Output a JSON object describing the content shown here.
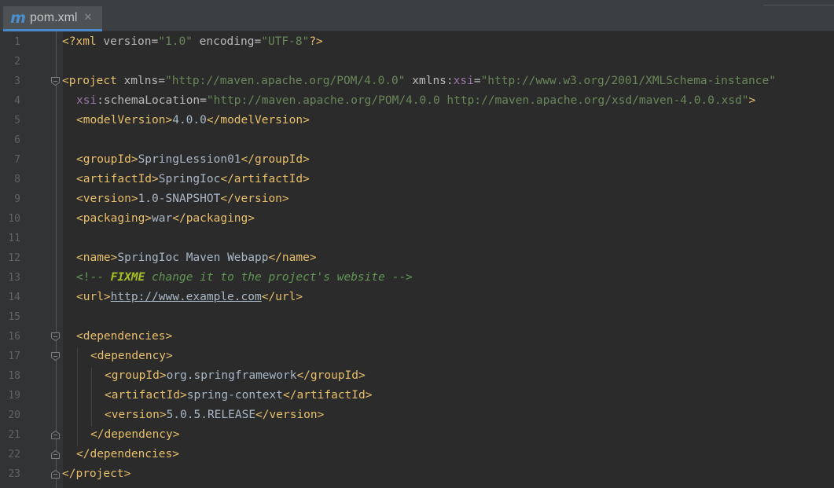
{
  "tab": {
    "icon": "maven-m-icon",
    "title": "pom.xml",
    "close": "✕",
    "active": true
  },
  "colors": {
    "tag": "#e8bf6a",
    "attribute": "#bababa",
    "namespace": "#9876aa",
    "value": "#6a8759",
    "text": "#a9b7c6",
    "comment": "#629755",
    "todo": "#a8c023",
    "accent": "#4a88c7"
  },
  "editor": {
    "lines": [
      {
        "n": "1",
        "indent": 0,
        "tokens": [
          {
            "t": "<?",
            "k": "punct"
          },
          {
            "t": "xml",
            "k": "tag"
          },
          {
            "t": " ",
            "k": "text"
          },
          {
            "t": "version",
            "k": "attr"
          },
          {
            "t": "=",
            "k": "attr"
          },
          {
            "t": "\"1.0\"",
            "k": "val"
          },
          {
            "t": " ",
            "k": "text"
          },
          {
            "t": "encoding",
            "k": "attr"
          },
          {
            "t": "=",
            "k": "attr"
          },
          {
            "t": "\"UTF-8\"",
            "k": "val"
          },
          {
            "t": "?>",
            "k": "punct"
          }
        ]
      },
      {
        "n": "2",
        "indent": 0,
        "tokens": []
      },
      {
        "n": "3",
        "indent": 0,
        "fold": "open",
        "tokens": [
          {
            "t": "<",
            "k": "punct"
          },
          {
            "t": "project",
            "k": "tag"
          },
          {
            "t": " ",
            "k": "text"
          },
          {
            "t": "xmlns",
            "k": "attr"
          },
          {
            "t": "=",
            "k": "attr"
          },
          {
            "t": "\"http://maven.apache.org/POM/4.0.0\"",
            "k": "val"
          },
          {
            "t": " ",
            "k": "text"
          },
          {
            "t": "xmlns:",
            "k": "attr"
          },
          {
            "t": "xsi",
            "k": "ns"
          },
          {
            "t": "=",
            "k": "attr"
          },
          {
            "t": "\"http://www.w3.org/2001/XMLSchema-instance\"",
            "k": "val"
          }
        ]
      },
      {
        "n": "4",
        "indent": 1,
        "tokens": [
          {
            "t": "xsi",
            "k": "ns"
          },
          {
            "t": ":schemaLocation",
            "k": "attr"
          },
          {
            "t": "=",
            "k": "attr"
          },
          {
            "t": "\"http://maven.apache.org/POM/4.0.0 http://maven.apache.org/xsd/maven-4.0.0.xsd\"",
            "k": "val"
          },
          {
            "t": ">",
            "k": "punct"
          }
        ]
      },
      {
        "n": "5",
        "indent": 1,
        "tokens": [
          {
            "t": "<modelVersion>",
            "k": "tag"
          },
          {
            "t": "4.0.0",
            "k": "text"
          },
          {
            "t": "</modelVersion>",
            "k": "tag"
          }
        ]
      },
      {
        "n": "6",
        "indent": 0,
        "tokens": []
      },
      {
        "n": "7",
        "indent": 1,
        "tokens": [
          {
            "t": "<groupId>",
            "k": "tag"
          },
          {
            "t": "SpringLession01",
            "k": "text"
          },
          {
            "t": "</groupId>",
            "k": "tag"
          }
        ]
      },
      {
        "n": "8",
        "indent": 1,
        "tokens": [
          {
            "t": "<artifactId>",
            "k": "tag"
          },
          {
            "t": "SpringIoc",
            "k": "text"
          },
          {
            "t": "</artifactId>",
            "k": "tag"
          }
        ]
      },
      {
        "n": "9",
        "indent": 1,
        "tokens": [
          {
            "t": "<version>",
            "k": "tag"
          },
          {
            "t": "1.0-SNAPSHOT",
            "k": "text"
          },
          {
            "t": "</version>",
            "k": "tag"
          }
        ]
      },
      {
        "n": "10",
        "indent": 1,
        "tokens": [
          {
            "t": "<packaging>",
            "k": "tag"
          },
          {
            "t": "war",
            "k": "text"
          },
          {
            "t": "</packaging>",
            "k": "tag"
          }
        ]
      },
      {
        "n": "11",
        "indent": 0,
        "tokens": []
      },
      {
        "n": "12",
        "indent": 1,
        "tokens": [
          {
            "t": "<name>",
            "k": "tag"
          },
          {
            "t": "SpringIoc Maven Webapp",
            "k": "text"
          },
          {
            "t": "</name>",
            "k": "tag"
          }
        ]
      },
      {
        "n": "13",
        "indent": 1,
        "tokens": [
          {
            "t": "<!--",
            "k": "cdelim"
          },
          {
            "t": " ",
            "k": "comment"
          },
          {
            "t": "FIXME",
            "k": "todo"
          },
          {
            "t": " change it to the project's website ",
            "k": "comment"
          },
          {
            "t": "-->",
            "k": "cdelim"
          }
        ]
      },
      {
        "n": "14",
        "indent": 1,
        "tokens": [
          {
            "t": "<url>",
            "k": "tag"
          },
          {
            "t": "http://www.example.com",
            "k": "url"
          },
          {
            "t": "</url>",
            "k": "tag"
          }
        ]
      },
      {
        "n": "15",
        "indent": 0,
        "tokens": []
      },
      {
        "n": "16",
        "indent": 1,
        "fold": "open",
        "tokens": [
          {
            "t": "<dependencies>",
            "k": "tag"
          }
        ]
      },
      {
        "n": "17",
        "indent": 2,
        "fold": "open",
        "tokens": [
          {
            "t": "<dependency>",
            "k": "tag"
          }
        ]
      },
      {
        "n": "18",
        "indent": 3,
        "tokens": [
          {
            "t": "<groupId>",
            "k": "tag"
          },
          {
            "t": "org.springframework",
            "k": "text"
          },
          {
            "t": "</groupId>",
            "k": "tag"
          }
        ]
      },
      {
        "n": "19",
        "indent": 3,
        "tokens": [
          {
            "t": "<artifactId>",
            "k": "tag"
          },
          {
            "t": "spring-context",
            "k": "text"
          },
          {
            "t": "</artifactId>",
            "k": "tag"
          }
        ]
      },
      {
        "n": "20",
        "indent": 3,
        "tokens": [
          {
            "t": "<version>",
            "k": "tag"
          },
          {
            "t": "5.0.5.RELEASE",
            "k": "text"
          },
          {
            "t": "</version>",
            "k": "tag"
          }
        ]
      },
      {
        "n": "21",
        "indent": 2,
        "fold": "close",
        "tokens": [
          {
            "t": "</dependency>",
            "k": "tag"
          }
        ]
      },
      {
        "n": "22",
        "indent": 1,
        "fold": "close",
        "tokens": [
          {
            "t": "</dependencies>",
            "k": "tag"
          }
        ]
      },
      {
        "n": "23",
        "indent": 0,
        "fold": "close",
        "tokens": [
          {
            "t": "</project>",
            "k": "tag"
          }
        ]
      }
    ]
  }
}
